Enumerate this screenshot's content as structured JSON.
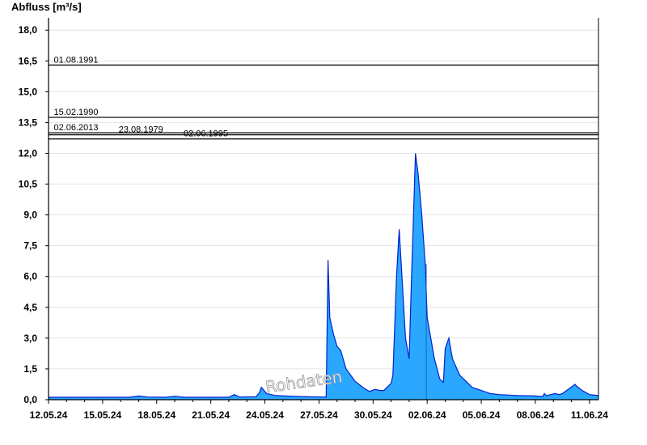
{
  "chart_data": {
    "type": "area",
    "ylabel": "Abfluss [m³/s]",
    "xlabel": "",
    "title": "",
    "ylim": [
      0,
      18.6
    ],
    "xlim": [
      0,
      30.5
    ],
    "grid": "horizontal",
    "yticks": [
      {
        "value": 0,
        "label": "0,0"
      },
      {
        "value": 1.5,
        "label": "1,5"
      },
      {
        "value": 3,
        "label": "3,0"
      },
      {
        "value": 4.5,
        "label": "4,5"
      },
      {
        "value": 6,
        "label": "6,0"
      },
      {
        "value": 7.5,
        "label": "7,5"
      },
      {
        "value": 9,
        "label": "9,0"
      },
      {
        "value": 10.5,
        "label": "10,5"
      },
      {
        "value": 12,
        "label": "12,0"
      },
      {
        "value": 13.5,
        "label": "13,5"
      },
      {
        "value": 15,
        "label": "15,0"
      },
      {
        "value": 16.5,
        "label": "16,5"
      },
      {
        "value": 18,
        "label": "18,0"
      }
    ],
    "xticks": [
      {
        "value": 0,
        "label": "12.05.24"
      },
      {
        "value": 3,
        "label": "15.05.24"
      },
      {
        "value": 6,
        "label": "18.05.24"
      },
      {
        "value": 9,
        "label": "21.05.24"
      },
      {
        "value": 12,
        "label": "24.05.24"
      },
      {
        "value": 15,
        "label": "27.05.24"
      },
      {
        "value": 18,
        "label": "30.05.24"
      },
      {
        "value": 21,
        "label": "02.06.24"
      },
      {
        "value": 24,
        "label": "05.06.24"
      },
      {
        "value": 27,
        "label": "08.06.24"
      },
      {
        "value": 30,
        "label": "11.06.24"
      }
    ],
    "reference_lines": [
      {
        "label": "01.08.1991",
        "value": 16.3,
        "label_x": 0.2
      },
      {
        "label": "15.02.1990",
        "value": 13.75,
        "label_x": 0.2
      },
      {
        "label": "02.06.2013",
        "value": 13.0,
        "label_x": 0.2
      },
      {
        "label": "23.08.1979",
        "value": 12.9,
        "label_x": 3.8
      },
      {
        "label": "02.06.1995",
        "value": 12.7,
        "label_x": 7.4
      }
    ],
    "series": [
      {
        "color": "#2aa7ff",
        "line_color": "#0022cc",
        "x": [
          0,
          4.5,
          5,
          5.5,
          6.5,
          7,
          7.5,
          10,
          10.3,
          10.6,
          11.5,
          11.7,
          11.8,
          12.1,
          12.6,
          13.5,
          14.4,
          15.4,
          15.5,
          15.6,
          15.8,
          16.0,
          16.2,
          16.5,
          17.0,
          17.5,
          17.8,
          18.1,
          18.4,
          18.6,
          19.0,
          19.1,
          19.3,
          19.45,
          19.6,
          19.8,
          20.0,
          20.1,
          20.35,
          20.5,
          20.6,
          20.7,
          20.9,
          21.0,
          21.4,
          21.7,
          21.9,
          22.0,
          22.2,
          22.4,
          22.8,
          23.5,
          24.0,
          24.5,
          25.0,
          26.0,
          27.0,
          27.4,
          27.5,
          27.6,
          28.1,
          28.3,
          28.5,
          28.9,
          29.2,
          29.3,
          29.6,
          30.0,
          30.5
        ],
        "y": [
          0.12,
          0.12,
          0.18,
          0.13,
          0.12,
          0.17,
          0.12,
          0.12,
          0.25,
          0.13,
          0.14,
          0.35,
          0.6,
          0.3,
          0.2,
          0.17,
          0.14,
          0.13,
          6.8,
          4.0,
          3.2,
          2.6,
          2.4,
          1.5,
          0.9,
          0.55,
          0.4,
          0.5,
          0.45,
          0.45,
          0.8,
          1.2,
          6.0,
          8.3,
          6.0,
          3.0,
          2.0,
          5.0,
          12.0,
          11.0,
          10.0,
          9.0,
          6.5,
          4.0,
          2.0,
          1.0,
          0.85,
          2.5,
          3.0,
          2.0,
          1.2,
          0.6,
          0.45,
          0.3,
          0.25,
          0.2,
          0.18,
          0.15,
          0.3,
          0.2,
          0.3,
          0.25,
          0.3,
          0.55,
          0.75,
          0.65,
          0.45,
          0.25,
          0.2
        ]
      }
    ],
    "annotations": [
      {
        "text": "Rohdaten",
        "x": 14.2,
        "y": 0.6
      }
    ]
  }
}
